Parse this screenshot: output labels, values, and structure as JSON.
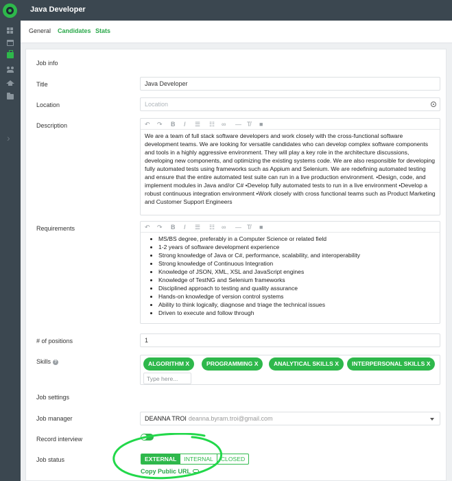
{
  "header": {
    "title": "Java Developer"
  },
  "tabs": [
    {
      "label": "General",
      "active": true
    },
    {
      "label": "Candidates",
      "active": false
    },
    {
      "label": "Stats",
      "active": false
    }
  ],
  "rail": {
    "icons": [
      "logo-icon",
      "dashboard-icon",
      "calendar-icon",
      "jobs-icon",
      "people-icon",
      "education-icon",
      "folder-icon",
      "expand-icon"
    ]
  },
  "form": {
    "section_job_info": "Job info",
    "title_label": "Title",
    "title_value": "Java Developer",
    "location_label": "Location",
    "location_placeholder": "Location",
    "description_label": "Description",
    "description_text": "We are a team of full stack software developers and work closely with the cross-functional software development teams. We are looking for versatile candidates who can develop complex software components and tools in a highly aggressive environment. They will play a key role in the architecture discussions, developing new components, and optimizing the existing systems code. We are also responsible for developing fully automated tests using frameworks such as Appium and Selenium. We are redefining automated testing and ensure that the entire automated test suite can run in a live production environment. •Design, code, and implement modules in Java and/or C# •Develop fully automated tests to run in a live environment •Develop a robust continuous integration environment •Work closely with cross functional teams such as Product Marketing and Customer Support Engineers",
    "requirements_label": "Requirements",
    "requirements": [
      "MS/BS degree, preferably in a Computer Science or related field",
      "1-2 years of software development experience",
      "Strong knowledge of Java or C#, performance, scalability, and interoperability",
      "Strong knowledge of Continuous Integration",
      "Knowledge of JSON, XML, XSL and JavaScript engines",
      "Knowledge of TestNG and Selenium frameworks",
      "Disciplined approach to testing and quality assurance",
      "Hands-on knowledge of version control systems",
      "Ability to think logically, diagnose and triage the technical issues",
      "Driven to execute and follow through"
    ],
    "positions_label": "# of positions",
    "positions_value": "1",
    "skills_label": "Skills",
    "skills": [
      "ALGORITHM X",
      "PROGRAMMING X",
      "ANALYTICAL SKILLS X",
      "INTERPERSONAL SKILLS X"
    ],
    "skills_placeholder": "Type here...",
    "section_job_settings": "Job settings",
    "manager_label": "Job manager",
    "manager_name": "DEANNA TROI",
    "manager_email": "deanna.byram.troi@gmail.com",
    "record_label": "Record interview",
    "record_on": true,
    "status_label": "Job status",
    "status_options": [
      "EXTERNAL",
      "INTERNAL",
      "CLOSED"
    ],
    "status_selected": "EXTERNAL",
    "copy_link_label": "Copy Public URL"
  },
  "toolbar_icons": [
    "undo-icon",
    "redo-icon",
    "bold-icon",
    "italic-icon",
    "bullet-list-icon",
    "numbered-list-icon",
    "link-icon",
    "horizontal-rule-icon",
    "clear-format-icon",
    "video-icon"
  ],
  "colors": {
    "accent": "#2eb84b",
    "rail": "#3b4750",
    "background": "#eef0f2"
  }
}
